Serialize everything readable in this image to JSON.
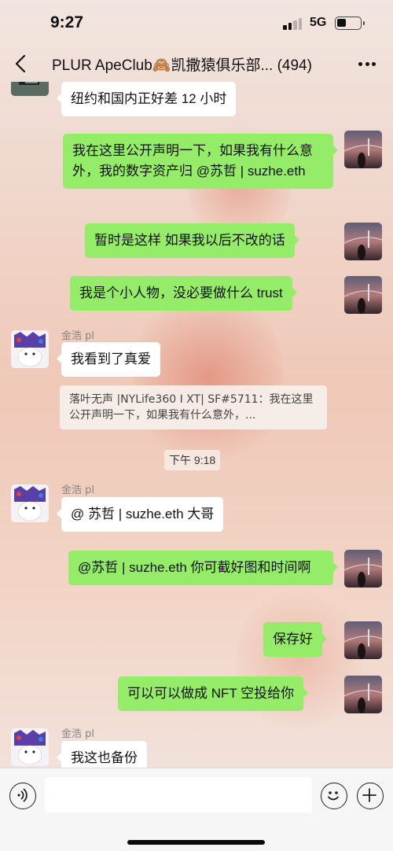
{
  "status_bar": {
    "time": "9:27",
    "network": "5G"
  },
  "nav": {
    "title": "PLUR ApeClub🙈凯撒猿俱乐部... (494)",
    "back_icon": "chevron-left-icon",
    "more_icon": "more-dots-icon"
  },
  "messages": [
    {
      "direction": "in",
      "text": "纽约和国内正好差 12 小时"
    },
    {
      "direction": "out",
      "text": "我在这里公开声明一下，如果我有什么意外，我的数字资产归 @苏哲 | suzhe.eth"
    },
    {
      "direction": "out",
      "text": "暂时是这样 如果我以后不改的话"
    },
    {
      "direction": "out",
      "text": "我是个小人物，没必要做什么 trust"
    },
    {
      "direction": "in",
      "sender": "金浩 pl",
      "text": "我看到了真爱",
      "quote": "落叶无声 |NYLife360 I XT| SF#5711：我在这里公开声明一下，如果我有什么意外，..."
    },
    {
      "direction": "in",
      "sender": "金浩 pl",
      "text": "@ 苏哲 | suzhe.eth 大哥"
    },
    {
      "direction": "out",
      "text": "@苏哲 | suzhe.eth 你可截好图和时间啊"
    },
    {
      "direction": "out",
      "text": "保存好"
    },
    {
      "direction": "out",
      "text": "可以可以做成 NFT 空投给你"
    },
    {
      "direction": "in",
      "sender": "金浩 pl",
      "text": "我这也备份"
    }
  ],
  "time_divider": "下午 9:18",
  "input_bar": {
    "voice_icon": "voice-icon",
    "emoji_icon": "emoji-icon",
    "plus_icon": "plus-icon",
    "input_value": ""
  },
  "colors": {
    "outgoing_bubble": "#95ec69",
    "incoming_bubble": "#ffffff",
    "name_text": "#8a8481"
  }
}
